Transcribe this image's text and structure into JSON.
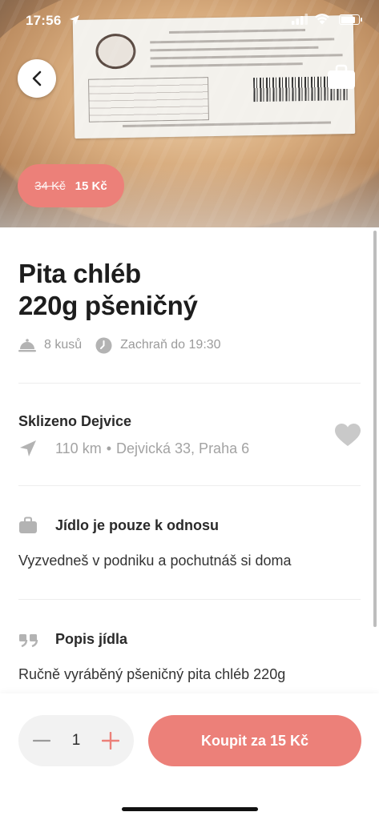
{
  "status_bar": {
    "time": "17:56",
    "battery_level": 0.85
  },
  "colors": {
    "accent": "#ec8079",
    "muted_text": "#9b9b9b",
    "icon_gray": "#b3b3b3"
  },
  "hero": {
    "price_old": "34 Kč",
    "price_new": "15 Kč"
  },
  "product": {
    "title_line1": "Pita chléb",
    "title_line2": "220g pšeničný",
    "quantity_available": "8 kusů",
    "rescue_until": "Zachraň do 19:30"
  },
  "shop": {
    "name": "Sklizeno Dejvice",
    "distance": "110 km",
    "separator": "•",
    "address": "Dejvická 33, Praha 6"
  },
  "pickup": {
    "heading": "Jídlo je pouze k odnosu",
    "text": "Vyzvedneš v podniku a pochutnáš si doma"
  },
  "description": {
    "heading": "Popis jídla",
    "text": "Ručně vyráběný pšeničný pita chléb 220g"
  },
  "order": {
    "quantity": "1",
    "buy_label": "Koupit za 15 Kč"
  },
  "icons": {
    "back": "chevron-left-icon",
    "bag": "shopping-bag-icon",
    "dish": "cloche-icon",
    "clock": "clock-icon",
    "location": "navigation-arrow-icon",
    "favorite": "heart-icon",
    "takeaway": "bag-icon",
    "quote": "quote-icon",
    "minus": "minus-icon",
    "plus": "plus-icon"
  }
}
